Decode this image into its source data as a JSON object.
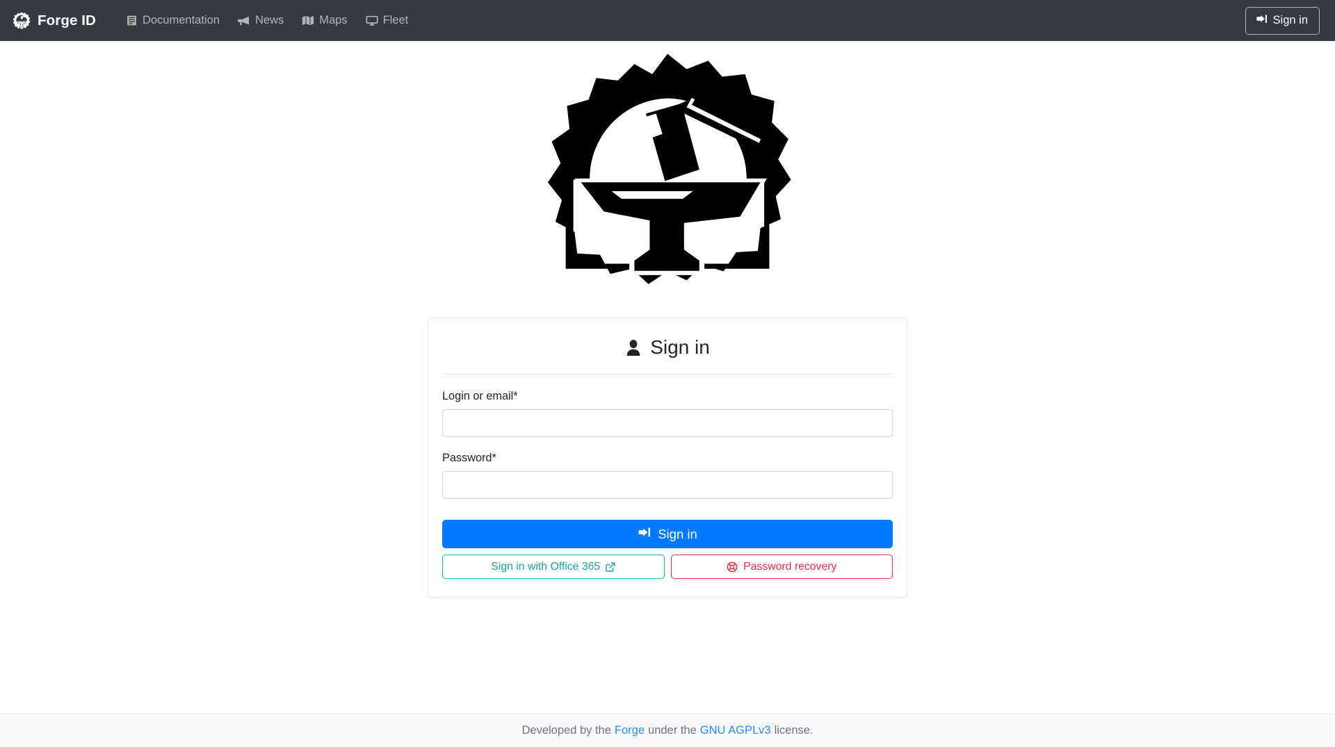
{
  "navbar": {
    "brand": {
      "label": "Forge ID",
      "logo_icon": "forge-gear-anvil-icon"
    },
    "links": [
      {
        "label": "Documentation",
        "icon": "book-icon"
      },
      {
        "label": "News",
        "icon": "bullhorn-icon"
      },
      {
        "label": "Maps",
        "icon": "map-icon"
      },
      {
        "label": "Fleet",
        "icon": "desktop-monitor-icon"
      }
    ],
    "signin_button": {
      "label": "Sign in",
      "icon": "sign-in-arrow-icon"
    },
    "background_color": "#343a40"
  },
  "hero": {
    "logo_icon": "forge-gear-hammer-anvil-logo",
    "logo_color": "#000000"
  },
  "card": {
    "title": "Sign in",
    "title_icon": "user-person-icon",
    "fields": [
      {
        "label": "Login or email*",
        "value": "",
        "placeholder": "",
        "type": "text",
        "name": "login-or-email"
      },
      {
        "label": "Password*",
        "value": "",
        "placeholder": "",
        "type": "password",
        "name": "password"
      }
    ],
    "primary_button": {
      "label": "Sign in",
      "icon": "sign-in-arrow-icon",
      "color": "#007bff"
    },
    "secondary_buttons": [
      {
        "label": "Sign in with Office 365",
        "icon": "external-link-icon",
        "color": "#20b2aa",
        "name": "office365"
      },
      {
        "label": "Password recovery",
        "icon": "life-ring-icon",
        "color": "#dc3545",
        "name": "password-recovery"
      }
    ]
  },
  "footer": {
    "prefix": "Developed by the",
    "link1": "Forge",
    "middle": "under the",
    "link2": "GNU AGPLv3",
    "suffix": "license.",
    "link_color": "#2a8cff",
    "background_color": "#f8f9fa"
  }
}
